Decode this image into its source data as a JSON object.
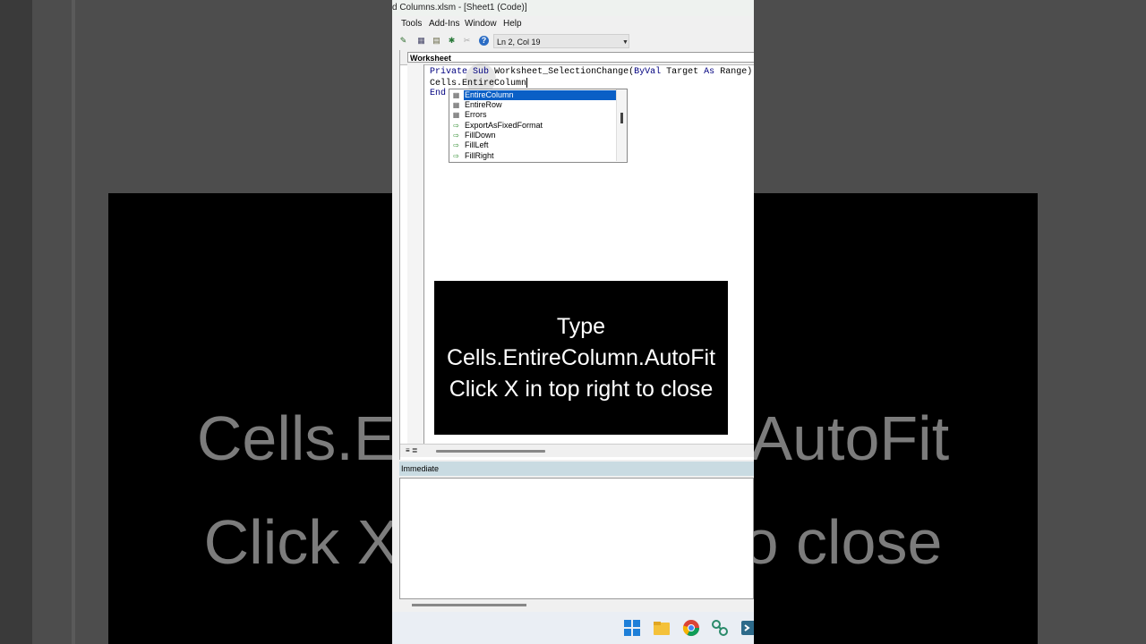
{
  "background": {
    "line1": "Cells.EntireColumn.AutoFit",
    "line2": "Click X in top right to close"
  },
  "window": {
    "title": "d Columns.xlsm - [Sheet1 (Code)]"
  },
  "menu": {
    "items": [
      "Tools",
      "Add-Ins",
      "Window",
      "Help"
    ]
  },
  "toolbar": {
    "status": "Ln 2, Col 19"
  },
  "code_window": {
    "object_selector": "Worksheet",
    "line1_kw1": "Private",
    "line1_kw2": "Sub",
    "line1_rest": "Worksheet_SelectionChange(",
    "line1_kw3": "ByVal",
    "line1_mid": "Target",
    "line1_kw4": "As",
    "line1_end": "Range)",
    "line2": "Cells.EntireColumn",
    "line3": "End"
  },
  "autocomplete": {
    "items": [
      {
        "label": "EntireColumn",
        "icon": "property-icon",
        "selected": true
      },
      {
        "label": "EntireRow",
        "icon": "property-icon"
      },
      {
        "label": "Errors",
        "icon": "property-icon"
      },
      {
        "label": "ExportAsFixedFormat",
        "icon": "method-icon"
      },
      {
        "label": "FillDown",
        "icon": "method-icon"
      },
      {
        "label": "FillLeft",
        "icon": "method-icon"
      },
      {
        "label": "FillRight",
        "icon": "method-icon"
      }
    ]
  },
  "overlay": {
    "line1": "Type",
    "line2": "Cells.EntireColumn.AutoFit",
    "line3": "Click X in top right to close"
  },
  "immediate": {
    "title": "Immediate"
  },
  "colors": {
    "selection": "#0a5fc6",
    "keyword": "#00007f",
    "immediate_header": "#c9dbe2"
  }
}
